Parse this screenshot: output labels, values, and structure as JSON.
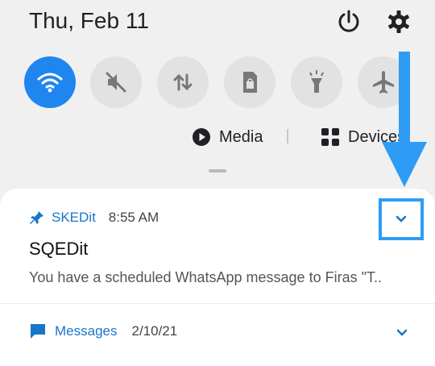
{
  "status": {
    "date": "Thu, Feb 11"
  },
  "header_icons": {
    "power": "power-icon",
    "settings": "gear-icon"
  },
  "quick_tiles": [
    {
      "name": "wifi-tile",
      "icon": "wifi-icon",
      "state": "on"
    },
    {
      "name": "sound-tile",
      "icon": "mute-icon",
      "state": "off"
    },
    {
      "name": "mobile-data-tile",
      "icon": "data-arrows-icon",
      "state": "off"
    },
    {
      "name": "sim-tile",
      "icon": "sim-icon",
      "state": "off"
    },
    {
      "name": "flashlight-tile",
      "icon": "flashlight-icon",
      "state": "off"
    },
    {
      "name": "airplane-tile",
      "icon": "airplane-icon",
      "state": "off"
    }
  ],
  "media": {
    "media_label": "Media",
    "devices_label": "Devices"
  },
  "notifications": [
    {
      "app": "SKEDit",
      "time": "8:55 AM",
      "title": "SQEDit",
      "body": "You have a scheduled WhatsApp message to Firas \"T.."
    },
    {
      "app": "Messages",
      "time": "2/10/21"
    }
  ],
  "colors": {
    "accent": "#1f86f0",
    "tile_off": "#e2e2e2",
    "highlight": "#2e9cf5",
    "app_label": "#1875c8"
  }
}
